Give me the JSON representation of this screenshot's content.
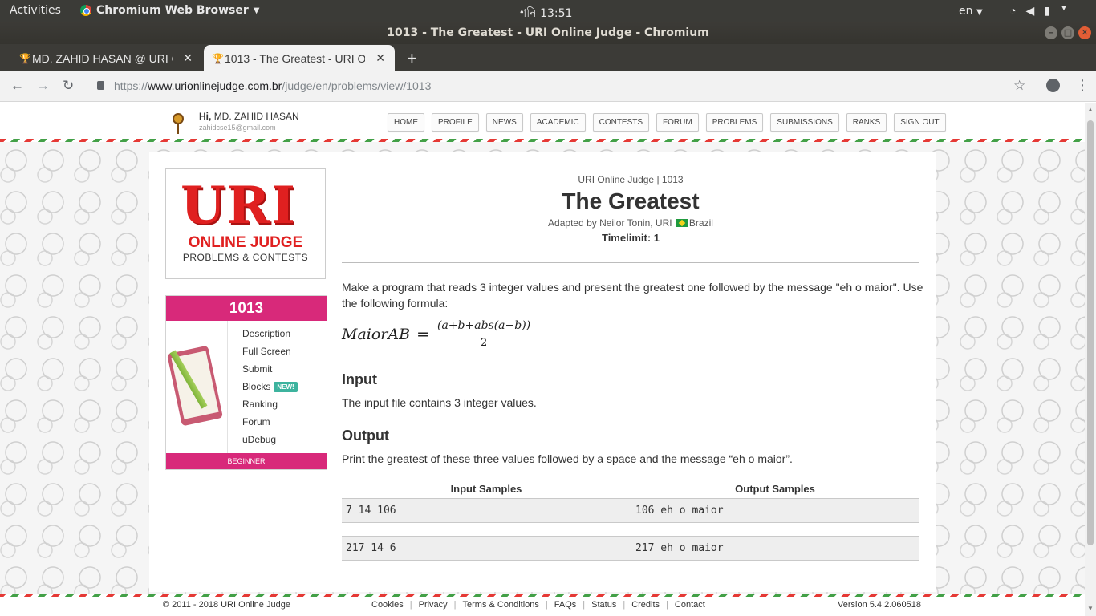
{
  "os": {
    "activities": "Activities",
    "app_name": "Chromium Web Browser",
    "clock": "শনি 13:51",
    "lang": "en"
  },
  "window": {
    "title": "1013 - The Greatest - URI Online Judge - Chromium"
  },
  "tabs": [
    {
      "label": "MD. ZAHID HASAN @ URI O",
      "active": false
    },
    {
      "label": "1013 - The Greatest - URI O",
      "active": true
    }
  ],
  "address": {
    "scheme": "https://",
    "host": "www.urionlinejudge.com.br",
    "path": "/judge/en/problems/view/1013"
  },
  "header": {
    "hi_prefix": "Hi,",
    "user_name": "MD. ZAHID HASAN",
    "email": "zahidcse15@gmail.com",
    "nav": [
      "HOME",
      "PROFILE",
      "NEWS",
      "ACADEMIC",
      "CONTESTS",
      "FORUM",
      "PROBLEMS",
      "SUBMISSIONS",
      "RANKS",
      "SIGN OUT"
    ]
  },
  "logo": {
    "uri": "URI",
    "online_judge": "ONLINE JUDGE",
    "subtitle": "PROBLEMS & CONTESTS"
  },
  "problem_box": {
    "number": "1013",
    "menu": [
      "Description",
      "Full Screen",
      "Submit",
      "Blocks",
      "Ranking",
      "Forum",
      "uDebug"
    ],
    "new_badge": "NEW!",
    "level": "BEGINNER"
  },
  "problem": {
    "meta": "URI Online Judge | 1013",
    "title": "The Greatest",
    "adapted_prefix": "Adapted by Neilor Tonin, URI",
    "country": "Brazil",
    "timelimit": "Timelimit: 1",
    "description": "Make a program that reads 3 integer values and present the greatest one followed by the message \"eh o maior\". Use the following formula:",
    "formula": {
      "lhs": "MaiorAB",
      "numerator": "(a+b+abs(a−b))",
      "denominator": "2"
    },
    "input_title": "Input",
    "input_text": "The input file contains 3 integer values.",
    "output_title": "Output",
    "output_text": "Print the greatest of these three values followed by a space and the message “eh o maior”.",
    "samples_headers": [
      "Input Samples",
      "Output Samples"
    ],
    "samples": [
      {
        "input": "7 14 106",
        "output": "106 eh o maior"
      },
      {
        "input": "217 14 6",
        "output": "217 eh o maior"
      }
    ]
  },
  "footer": {
    "copyright": "© 2011 - 2018 URI Online Judge",
    "links": [
      "Cookies",
      "Privacy",
      "Terms & Conditions",
      "FAQs",
      "Status",
      "Credits",
      "Contact"
    ],
    "version": "Version 5.4.2.060518"
  },
  "colors": {
    "accent_pink": "#d8297a",
    "logo_red": "#e02020",
    "new_badge": "#3db39e"
  }
}
